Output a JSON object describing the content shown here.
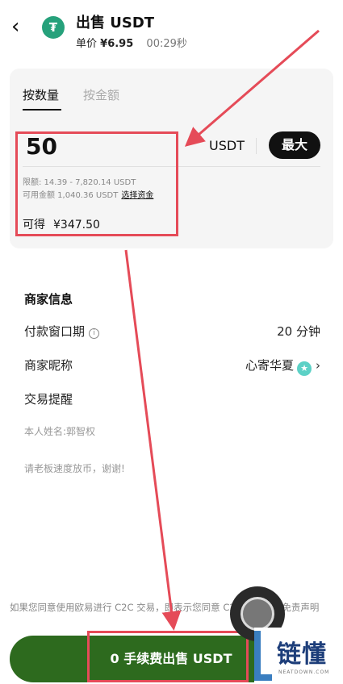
{
  "header": {
    "back_icon": "chevron-left-icon",
    "logo_glyph": "₮",
    "title": "出售 USDT",
    "price_label": "单价",
    "price_value": "¥6.95",
    "timer": "00:29秒"
  },
  "tabs": [
    {
      "label": "按数量",
      "active": true
    },
    {
      "label": "按金额",
      "active": false
    }
  ],
  "input": {
    "amount": "50",
    "unit": "USDT",
    "max_label": "最大"
  },
  "limit_text": "限额: 14.39 - 7,820.14 USDT",
  "available_text": "可用金额 1,040.36 USDT",
  "select_funds_label": "选择资金",
  "receive": {
    "label": "可得",
    "value": "¥347.50"
  },
  "merchant": {
    "section_title": "商家信息",
    "rows": [
      {
        "label": "付款窗口期",
        "value": "20 分钟"
      },
      {
        "label": "商家昵称",
        "value": "心寄华夏"
      },
      {
        "label": "交易提醒",
        "value": ""
      }
    ],
    "notes": [
      "本人姓名:郭智权",
      "请老板速度放币，谢谢!"
    ]
  },
  "disclaimer": "如果您同意使用欧易进行 C2C 交易，即表示您同意 C2C 交易法律免责声明",
  "sell_button_label": "0 手续费出售 USDT",
  "watermark": {
    "text": "链懂",
    "sub": "NEATDOWN.COM"
  },
  "colors": {
    "usdt_green": "#26a17b",
    "button_green": "#2d6a1e",
    "annotation_red": "#e54b58"
  }
}
